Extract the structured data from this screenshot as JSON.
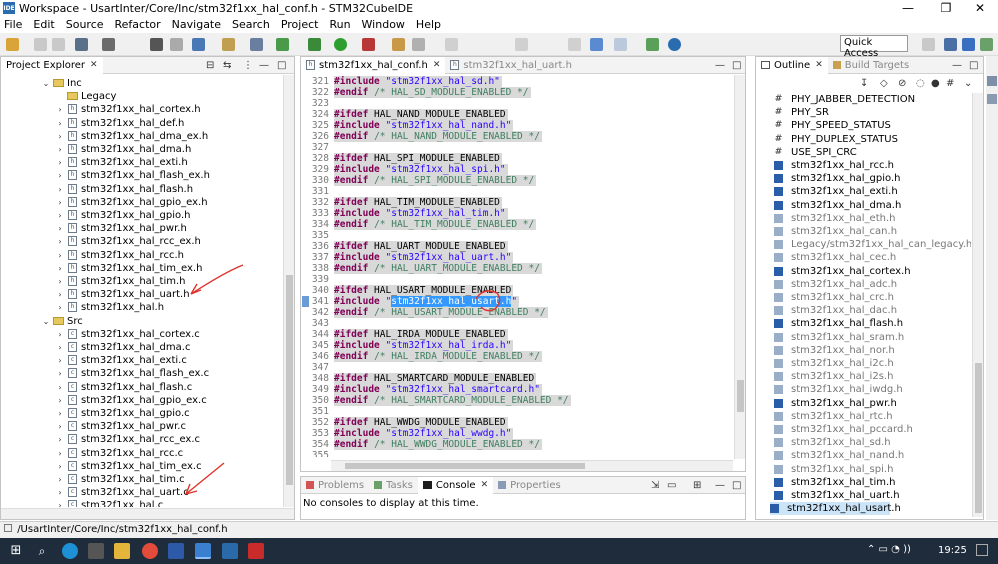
{
  "window": {
    "title": "Workspace - UsartInter/Core/Inc/stm32f1xx_hal_conf.h - STM32CubeIDE",
    "minimize": "—",
    "maximize": "❐",
    "close": "✕"
  },
  "menu": [
    "File",
    "Edit",
    "Source",
    "Refactor",
    "Navigate",
    "Search",
    "Project",
    "Run",
    "Window",
    "Help"
  ],
  "quick_access": "Quick Access",
  "project_explorer": {
    "tab": "Project Explorer",
    "inc_folder": "Inc",
    "legacy_folder": "Legacy",
    "inc_files": [
      "stm32f1xx_hal_cortex.h",
      "stm32f1xx_hal_def.h",
      "stm32f1xx_hal_dma_ex.h",
      "stm32f1xx_hal_dma.h",
      "stm32f1xx_hal_exti.h",
      "stm32f1xx_hal_flash_ex.h",
      "stm32f1xx_hal_flash.h",
      "stm32f1xx_hal_gpio_ex.h",
      "stm32f1xx_hal_gpio.h",
      "stm32f1xx_hal_pwr.h",
      "stm32f1xx_hal_rcc_ex.h",
      "stm32f1xx_hal_rcc.h",
      "stm32f1xx_hal_tim_ex.h",
      "stm32f1xx_hal_tim.h",
      "stm32f1xx_hal_uart.h",
      "stm32f1xx_hal.h"
    ],
    "src_folder": "Src",
    "src_files": [
      "stm32f1xx_hal_cortex.c",
      "stm32f1xx_hal_dma.c",
      "stm32f1xx_hal_exti.c",
      "stm32f1xx_hal_flash_ex.c",
      "stm32f1xx_hal_flash.c",
      "stm32f1xx_hal_gpio_ex.c",
      "stm32f1xx_hal_gpio.c",
      "stm32f1xx_hal_pwr.c",
      "stm32f1xx_hal_rcc_ex.c",
      "stm32f1xx_hal_rcc.c",
      "stm32f1xx_hal_tim_ex.c",
      "stm32f1xx_hal_tim.c",
      "stm32f1xx_hal_uart.c",
      "stm32f1xx_hal.c"
    ]
  },
  "editor": {
    "tabs": [
      "stm32f1xx_hal_conf.h",
      "stm32f1xx_hal_uart.h"
    ],
    "lines": [
      {
        "n": "321",
        "c": "#include \"stm32f1xx_hal_sd.h\""
      },
      {
        "n": "322",
        "c": "#endif /* HAL_SD_MODULE_ENABLED */"
      },
      {
        "n": "323",
        "c": ""
      },
      {
        "n": "324",
        "c": "#ifdef HAL_NAND_MODULE_ENABLED"
      },
      {
        "n": "325",
        "c": "#include \"stm32f1xx_hal_nand.h\""
      },
      {
        "n": "326",
        "c": "#endif /* HAL_NAND_MODULE_ENABLED */"
      },
      {
        "n": "327",
        "c": ""
      },
      {
        "n": "328",
        "c": "#ifdef HAL_SPI_MODULE_ENABLED"
      },
      {
        "n": "329",
        "c": "#include \"stm32f1xx_hal_spi.h\""
      },
      {
        "n": "330",
        "c": "#endif /* HAL_SPI_MODULE_ENABLED */"
      },
      {
        "n": "331",
        "c": ""
      },
      {
        "n": "332",
        "c": "#ifdef HAL_TIM_MODULE_ENABLED"
      },
      {
        "n": "333",
        "c": "#include \"stm32f1xx_hal_tim.h\""
      },
      {
        "n": "334",
        "c": "#endif /* HAL_TIM_MODULE_ENABLED */"
      },
      {
        "n": "335",
        "c": ""
      },
      {
        "n": "336",
        "c": "#ifdef HAL_UART_MODULE_ENABLED"
      },
      {
        "n": "337",
        "c": "#include \"stm32f1xx_hal_uart.h\""
      },
      {
        "n": "338",
        "c": "#endif /* HAL_UART_MODULE_ENABLED */"
      },
      {
        "n": "339",
        "c": ""
      },
      {
        "n": "340",
        "c": "#ifdef HAL_USART_MODULE_ENABLED"
      },
      {
        "n": "341",
        "c": "#include \"stm32f1xx_hal_usart.h\""
      },
      {
        "n": "342",
        "c": "#endif /* HAL_USART_MODULE_ENABLED */"
      },
      {
        "n": "343",
        "c": ""
      },
      {
        "n": "344",
        "c": "#ifdef HAL_IRDA_MODULE_ENABLED"
      },
      {
        "n": "345",
        "c": "#include \"stm32f1xx_hal_irda.h\""
      },
      {
        "n": "346",
        "c": "#endif /* HAL_IRDA_MODULE_ENABLED */"
      },
      {
        "n": "347",
        "c": ""
      },
      {
        "n": "348",
        "c": "#ifdef HAL_SMARTCARD_MODULE_ENABLED"
      },
      {
        "n": "349",
        "c": "#include \"stm32f1xx_hal_smartcard.h\""
      },
      {
        "n": "350",
        "c": "#endif /* HAL_SMARTCARD_MODULE_ENABLED */"
      },
      {
        "n": "351",
        "c": ""
      },
      {
        "n": "352",
        "c": "#ifdef HAL_WWDG_MODULE_ENABLED"
      },
      {
        "n": "353",
        "c": "#include \"stm32f1xx_hal_wwdg.h\""
      },
      {
        "n": "354",
        "c": "#endif /* HAL_WWDG_MODULE_ENABLED */"
      },
      {
        "n": "355",
        "c": ""
      }
    ]
  },
  "console": {
    "tabs": [
      "Problems",
      "Tasks",
      "Console",
      "Properties"
    ],
    "message": "No consoles to display at this time."
  },
  "outline": {
    "tabs": [
      "Outline",
      "Build Targets"
    ],
    "items": [
      {
        "t": "PHY_JABBER_DETECTION",
        "k": "macro"
      },
      {
        "t": "PHY_SR",
        "k": "macro"
      },
      {
        "t": "PHY_SPEED_STATUS",
        "k": "macro"
      },
      {
        "t": "PHY_DUPLEX_STATUS",
        "k": "macro"
      },
      {
        "t": "USE_SPI_CRC",
        "k": "macro"
      },
      {
        "t": "stm32f1xx_hal_rcc.h",
        "k": "inc"
      },
      {
        "t": "stm32f1xx_hal_gpio.h",
        "k": "inc"
      },
      {
        "t": "stm32f1xx_hal_exti.h",
        "k": "inc"
      },
      {
        "t": "stm32f1xx_hal_dma.h",
        "k": "inc"
      },
      {
        "t": "stm32f1xx_hal_eth.h",
        "k": "inc-g"
      },
      {
        "t": "stm32f1xx_hal_can.h",
        "k": "inc-g"
      },
      {
        "t": "Legacy/stm32f1xx_hal_can_legacy.h",
        "k": "inc-g"
      },
      {
        "t": "stm32f1xx_hal_cec.h",
        "k": "inc-g"
      },
      {
        "t": "stm32f1xx_hal_cortex.h",
        "k": "inc"
      },
      {
        "t": "stm32f1xx_hal_adc.h",
        "k": "inc-g"
      },
      {
        "t": "stm32f1xx_hal_crc.h",
        "k": "inc-g"
      },
      {
        "t": "stm32f1xx_hal_dac.h",
        "k": "inc-g"
      },
      {
        "t": "stm32f1xx_hal_flash.h",
        "k": "inc"
      },
      {
        "t": "stm32f1xx_hal_sram.h",
        "k": "inc-g"
      },
      {
        "t": "stm32f1xx_hal_nor.h",
        "k": "inc-g"
      },
      {
        "t": "stm32f1xx_hal_i2c.h",
        "k": "inc-g"
      },
      {
        "t": "stm32f1xx_hal_i2s.h",
        "k": "inc-g"
      },
      {
        "t": "stm32f1xx_hal_iwdg.h",
        "k": "inc-g"
      },
      {
        "t": "stm32f1xx_hal_pwr.h",
        "k": "inc"
      },
      {
        "t": "stm32f1xx_hal_rtc.h",
        "k": "inc-g"
      },
      {
        "t": "stm32f1xx_hal_pccard.h",
        "k": "inc-g"
      },
      {
        "t": "stm32f1xx_hal_sd.h",
        "k": "inc-g"
      },
      {
        "t": "stm32f1xx_hal_nand.h",
        "k": "inc-g"
      },
      {
        "t": "stm32f1xx_hal_spi.h",
        "k": "inc-g"
      },
      {
        "t": "stm32f1xx_hal_tim.h",
        "k": "inc"
      },
      {
        "t": "stm32f1xx_hal_uart.h",
        "k": "inc"
      },
      {
        "t": "stm32f1xx_hal_usart.h",
        "k": "inc-sel"
      }
    ]
  },
  "status": {
    "path": "/UsartInter/Core/Inc/stm32f1xx_hal_conf.h"
  },
  "taskbar": {
    "time": "19:25"
  },
  "colors": {
    "keyword": "#7f0055",
    "string": "#2a00ff",
    "comment": "#3f7f5f",
    "selection": "#3399ff",
    "annotation": "#e0322c"
  }
}
